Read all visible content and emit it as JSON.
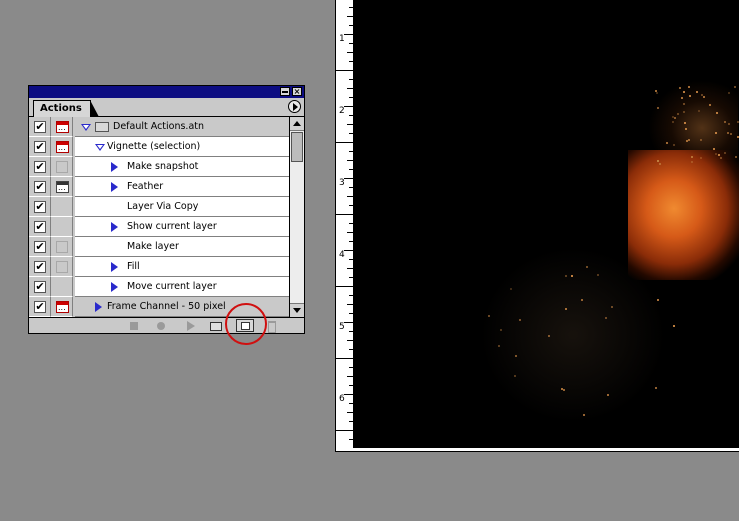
{
  "palette": {
    "tab_label": "Actions",
    "rows": [
      {
        "checked": true,
        "dialog": "red",
        "indent": "set",
        "expand": "down",
        "label": "Default Actions.atn",
        "bg": "gray"
      },
      {
        "checked": true,
        "dialog": "red",
        "indent": "action",
        "expand": "down",
        "label": "Vignette (selection)",
        "bg": "white"
      },
      {
        "checked": true,
        "dialog": "empty",
        "indent": "command",
        "expand": "right",
        "label": "Make snapshot",
        "bg": "white"
      },
      {
        "checked": true,
        "dialog": "black",
        "indent": "command",
        "expand": "right",
        "label": "Feather",
        "bg": "white"
      },
      {
        "checked": true,
        "dialog": "none",
        "indent": "command",
        "expand": "none",
        "label": "Layer Via Copy",
        "bg": "white"
      },
      {
        "checked": true,
        "dialog": "none",
        "indent": "command",
        "expand": "right",
        "label": "Show current layer",
        "bg": "white"
      },
      {
        "checked": true,
        "dialog": "empty",
        "indent": "command",
        "expand": "none",
        "label": "Make layer",
        "bg": "white"
      },
      {
        "checked": true,
        "dialog": "empty",
        "indent": "command",
        "expand": "right",
        "label": "Fill",
        "bg": "white"
      },
      {
        "checked": true,
        "dialog": "none",
        "indent": "command",
        "expand": "right",
        "label": "Move current layer",
        "bg": "white"
      },
      {
        "checked": true,
        "dialog": "red",
        "indent": "action",
        "expand": "right",
        "label": "Frame Channel - 50 pixel",
        "bg": "gray"
      }
    ],
    "toolbar": [
      "stop",
      "record",
      "play",
      "new-set",
      "new-action",
      "delete"
    ]
  },
  "ruler": {
    "numbers": [
      "1",
      "2",
      "3",
      "4",
      "5",
      "6"
    ]
  },
  "colors": {
    "titlebar": "#0d0d82",
    "expand_triangle": "#2a2acc",
    "highlight_circle": "#d01010",
    "canvas": "#000000"
  }
}
